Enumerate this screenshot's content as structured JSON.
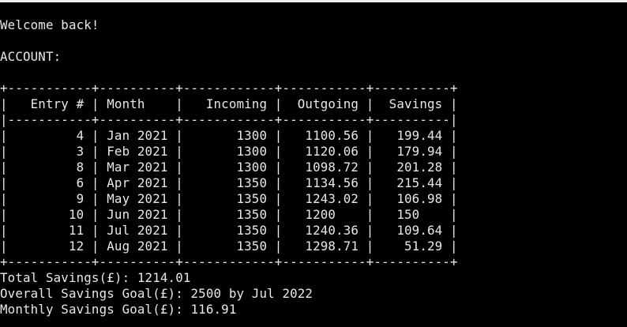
{
  "colors": {
    "background": "#000000",
    "text": "#e8e8e8",
    "window_top_strip": "#ededed"
  },
  "terminal": {
    "welcome": "Welcome back!",
    "account_label": "ACCOUNT:",
    "table": {
      "border_top": "+-----------+----------+------------+-----------+----------+",
      "header": "|   Entry # | Month    |   Incoming |  Outgoing |  Savings |",
      "header_separator": "|-----------+----------+------------+-----------+----------|",
      "columns": [
        "Entry #",
        "Month",
        "Incoming",
        "Outgoing",
        "Savings"
      ],
      "rows": [
        {
          "entry": "4",
          "month": "Jan 2021",
          "incoming": "1300",
          "outgoing": "1100.56",
          "savings": "199.44",
          "text": "|         4 | Jan 2021 |       1300 |   1100.56 |   199.44 |"
        },
        {
          "entry": "3",
          "month": "Feb 2021",
          "incoming": "1300",
          "outgoing": "1120.06",
          "savings": "179.94",
          "text": "|         3 | Feb 2021 |       1300 |   1120.06 |   179.94 |"
        },
        {
          "entry": "8",
          "month": "Mar 2021",
          "incoming": "1300",
          "outgoing": "1098.72",
          "savings": "201.28",
          "text": "|         8 | Mar 2021 |       1300 |   1098.72 |   201.28 |"
        },
        {
          "entry": "6",
          "month": "Apr 2021",
          "incoming": "1350",
          "outgoing": "1134.56",
          "savings": "215.44",
          "text": "|         6 | Apr 2021 |       1350 |   1134.56 |   215.44 |"
        },
        {
          "entry": "9",
          "month": "May 2021",
          "incoming": "1350",
          "outgoing": "1243.02",
          "savings": "106.98",
          "text": "|         9 | May 2021 |       1350 |   1243.02 |   106.98 |"
        },
        {
          "entry": "10",
          "month": "Jun 2021",
          "incoming": "1350",
          "outgoing": "1200",
          "savings": "150",
          "text": "|        10 | Jun 2021 |       1350 |   1200    |   150    |"
        },
        {
          "entry": "11",
          "month": "Jul 2021",
          "incoming": "1350",
          "outgoing": "1240.36",
          "savings": "109.64",
          "text": "|        11 | Jul 2021 |       1350 |   1240.36 |   109.64 |"
        },
        {
          "entry": "12",
          "month": "Aug 2021",
          "incoming": "1350",
          "outgoing": "1298.71",
          "savings": "51.29",
          "text": "|        12 | Aug 2021 |       1350 |   1298.71 |    51.29 |"
        }
      ],
      "border_bottom": "+-----------+----------+------------+-----------+----------+"
    },
    "total_savings": "Total Savings(£): 1214.01",
    "overall_goal": "Overall Savings Goal(£): 2500 by Jul 2022",
    "monthly_goal": "Monthly Savings Goal(£): 116.91"
  }
}
